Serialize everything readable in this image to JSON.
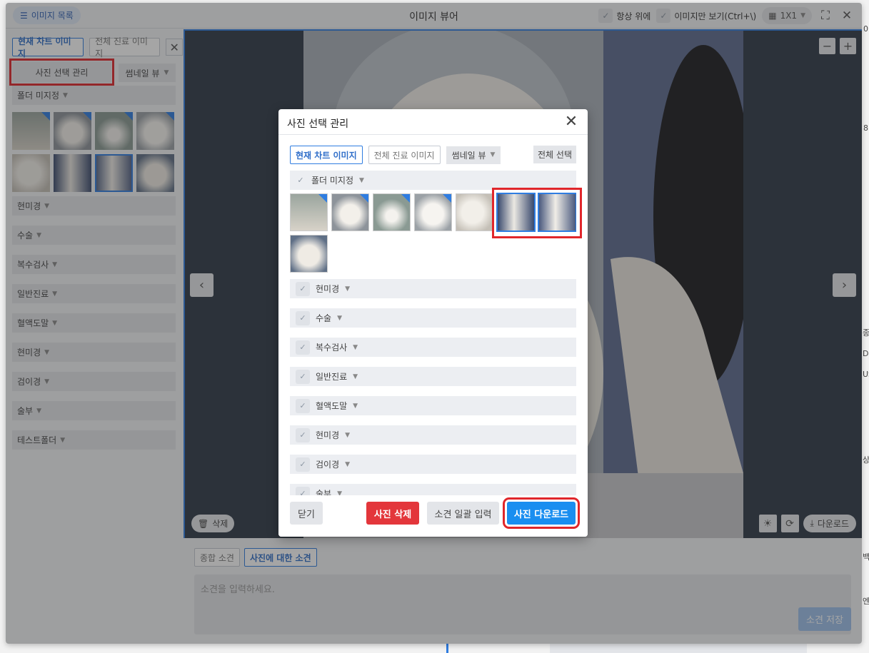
{
  "viewer": {
    "list_button": "이미지 목록",
    "title": "이미지 뷰어",
    "always_on_top": "항상 위에",
    "image_only": "이미지만 보기(Ctrl+\\)",
    "layout": "1X1"
  },
  "left_panel": {
    "tab_current": "현재 차트 이미지",
    "tab_all": "전체 진료 이미지",
    "manage_button": "사진 선택 관리",
    "thumb_view": "썸네일 뷰",
    "unassigned_folder": "폴더 미지정",
    "folders": [
      "현미경",
      "수술",
      "복수검사",
      "일반진료",
      "혈액도말",
      "현미경",
      "검이경",
      "술부",
      "테스트폴더"
    ]
  },
  "stage": {
    "delete_label": "삭제",
    "download_label": "다운로드"
  },
  "opinion": {
    "tab_general": "종합 소견",
    "tab_photo": "사진에 대한 소견",
    "placeholder": "소견을 입력하세요.",
    "save": "소견 저장"
  },
  "modal": {
    "title": "사진 선택 관리",
    "tab_current": "현재 차트 이미지",
    "tab_all": "전체 진료 이미지",
    "thumb_view": "썸네일 뷰",
    "select_all": "전체 선택",
    "unassigned_folder": "폴더 미지정",
    "folders": [
      "현미경",
      "수술",
      "복수검사",
      "일반진료",
      "혈액도말",
      "현미경",
      "검이경",
      "술부"
    ],
    "close": "닫기",
    "delete": "사진 삭제",
    "bulk_opinion": "소견 일괄 입력",
    "download": "사진 다운로드"
  },
  "background": {
    "fragments": [
      "0",
      "8",
      "종",
      "DI",
      "US",
      "상",
      "백",
      "엔"
    ]
  },
  "colors": {
    "accent": "#2f7de1",
    "danger": "#e3363b",
    "download": "#1a8ef0",
    "highlight": "#e0262b"
  }
}
